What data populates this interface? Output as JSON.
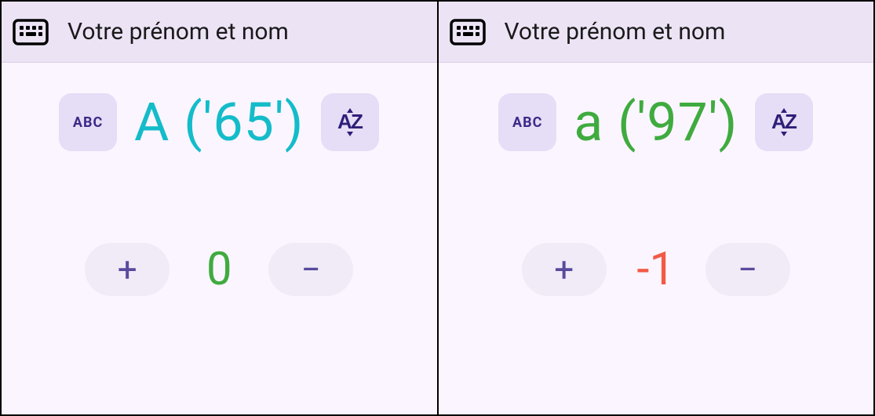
{
  "panels": [
    {
      "title": "Votre prénom et nom",
      "abc_label": "ABC",
      "char_display": "A ('65')",
      "char_color": "teal",
      "plus": "+",
      "minus": "−",
      "counter": "0",
      "counter_color": "green"
    },
    {
      "title": "Votre prénom et nom",
      "abc_label": "ABC",
      "char_display": "a ('97')",
      "char_color": "green",
      "plus": "+",
      "minus": "−",
      "counter": "-1",
      "counter_color": "red"
    }
  ]
}
